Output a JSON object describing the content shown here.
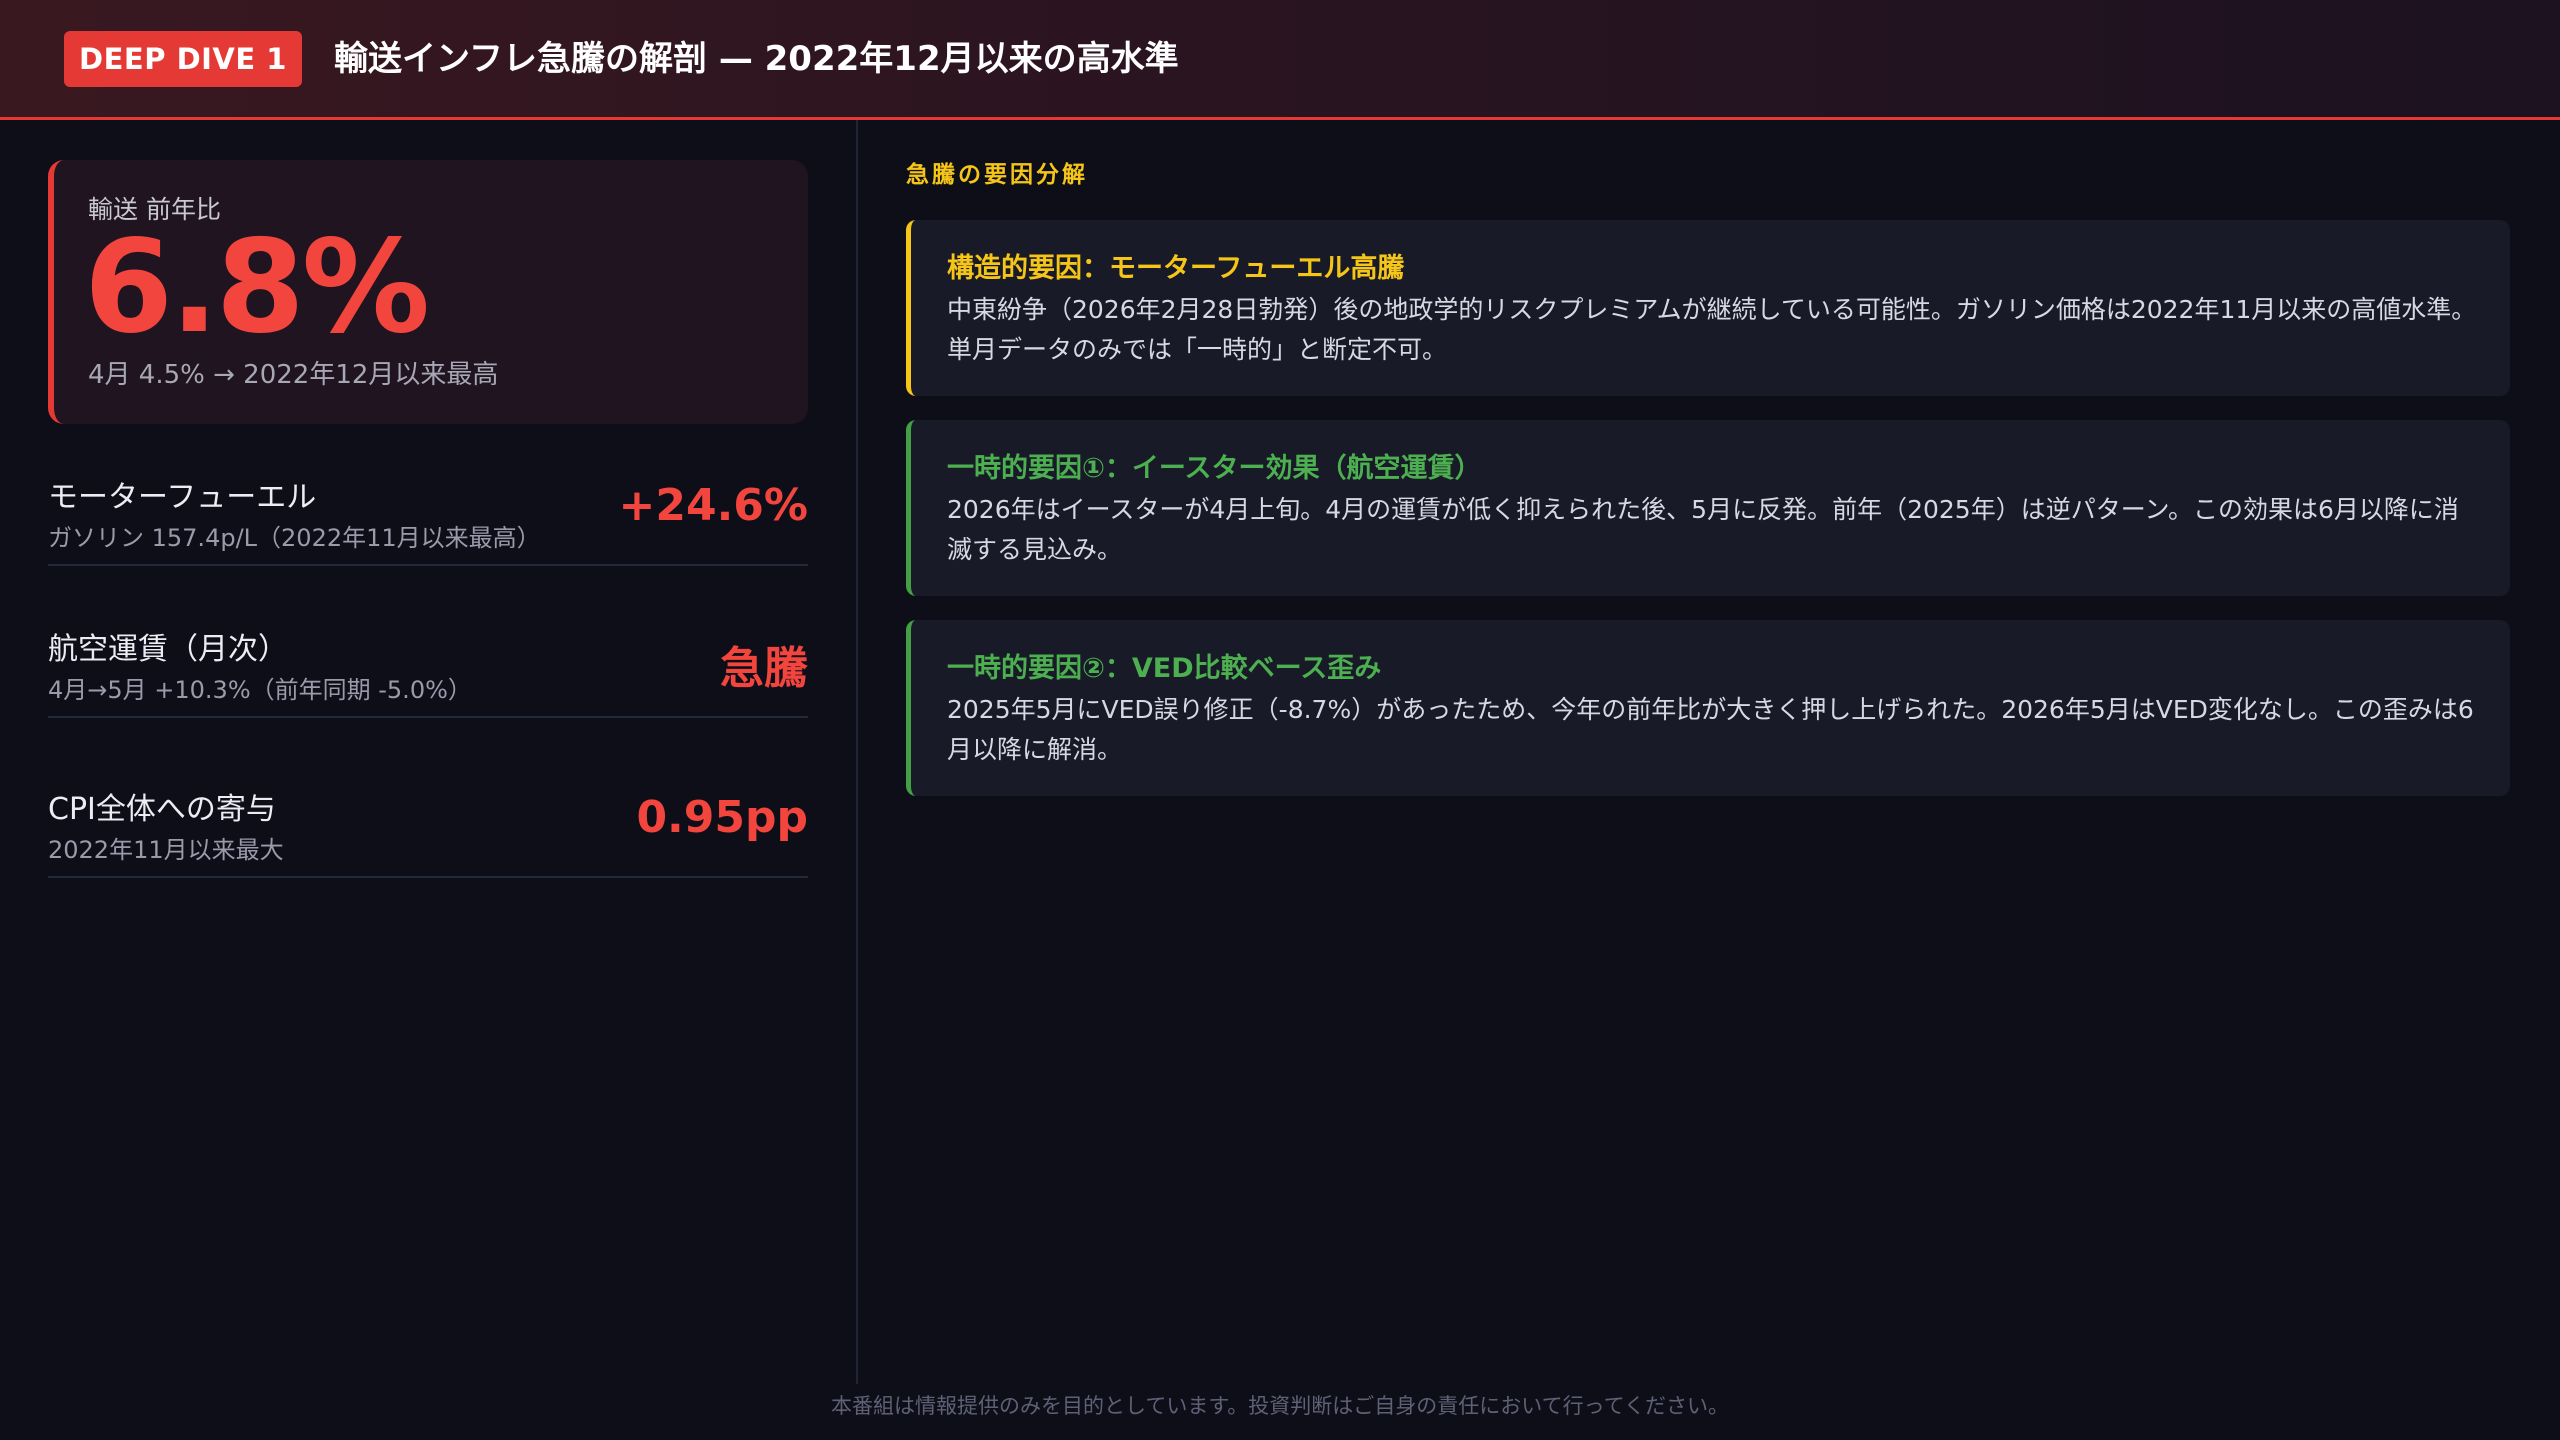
{
  "header": {
    "badge": "DEEP DIVE 1",
    "title": "輸送インフレ急騰の解剖 — 2022年12月以来の高水準"
  },
  "hero": {
    "label": "輸送 前年比",
    "value": "6.8%",
    "sub": "4月 4.5% → 2022年12月以来最高"
  },
  "metrics": [
    {
      "name": "モーターフューエル",
      "sub": "ガソリン 157.4p/L（2022年11月以来最高）",
      "value": "+24.6%"
    },
    {
      "name": "航空運賃（月次）",
      "sub": "4月→5月 +10.3%（前年同期 -5.0%）",
      "value": "急騰"
    },
    {
      "name": "CPI全体への寄与",
      "sub": "2022年11月以来最大",
      "value": "0.95pp"
    }
  ],
  "analysis": {
    "section_title": "急騰の要因分解",
    "factors": [
      {
        "title": "構造的要因：モーターフューエル高騰",
        "body": "中東紛争（2026年2月28日勃発）後の地政学的リスクプレミアムが継続している可能性。ガソリン価格は2022年11月以来の高値水準。単月データのみでは「一時的」と断定不可。"
      },
      {
        "title": "一時的要因①：イースター効果（航空運賃）",
        "body": "2026年はイースターが4月上旬。4月の運賃が低く抑えられた後、5月に反発。前年（2025年）は逆パターン。この効果は6月以降に消滅する見込み。"
      },
      {
        "title": "一時的要因②：VED比較ベース歪み",
        "body": "2025年5月にVED誤り修正（-8.7%）があったため、今年の前年比が大きく押し上げられた。2026年5月はVED変化なし。この歪みは6月以降に解消。"
      }
    ]
  },
  "footer": {
    "disclaimer": "本番組は情報提供のみを目的としています。投資判断はご自身の責任において行ってください。"
  },
  "colors": {
    "accent_red": "#e53935",
    "accent_yellow": "#f5c518",
    "accent_green": "#43a047",
    "background": "#0e0e19"
  }
}
